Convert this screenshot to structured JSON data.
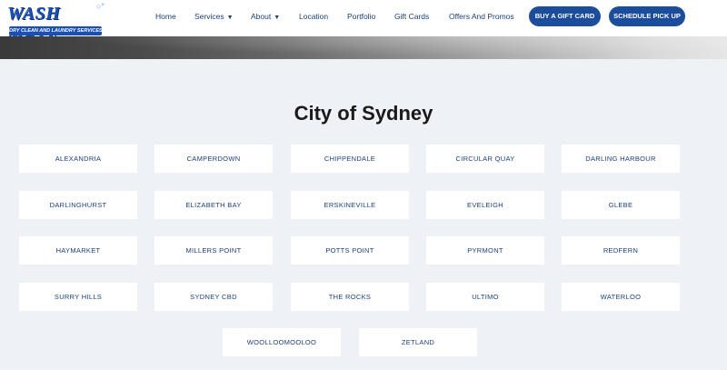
{
  "brand": {
    "logo_text": "WASH MATE",
    "logo_tagline": "DRY CLEAN AND LAUNDRY SERVICES"
  },
  "nav": {
    "home": "Home",
    "services": "Services",
    "about": "About",
    "location": "Location",
    "portfolio": "Portfolio",
    "gift_cards": "Gift Cards",
    "offers": "Offers And Promos"
  },
  "buttons": {
    "gift_card": "BUY A GIFT CARD",
    "schedule": "SCHEDULE PICK UP"
  },
  "section": {
    "title": "City of Sydney",
    "suburbs": [
      "ALEXANDRIA",
      "CAMPERDOWN",
      "CHIPPENDALE",
      "CIRCULAR QUAY",
      "DARLING HARBOUR",
      "DARLINGHURST",
      "ELIZABETH BAY",
      "ERSKINEVILLE",
      "EVELEIGH",
      "GLEBE",
      "HAYMARKET",
      "MILLERS POINT",
      "POTTS POINT",
      "PYRMONT",
      "REDFERN",
      "SURRY HILLS",
      "SYDNEY CBD",
      "THE ROCKS",
      "ULTIMO",
      "WATERLOO",
      "WOOLLOOMOOLOO",
      "ZETLAND"
    ]
  },
  "colors": {
    "brand_blue": "#1c4d9c",
    "nav_text": "#1b3f7a",
    "page_bg": "#eef2f6"
  }
}
